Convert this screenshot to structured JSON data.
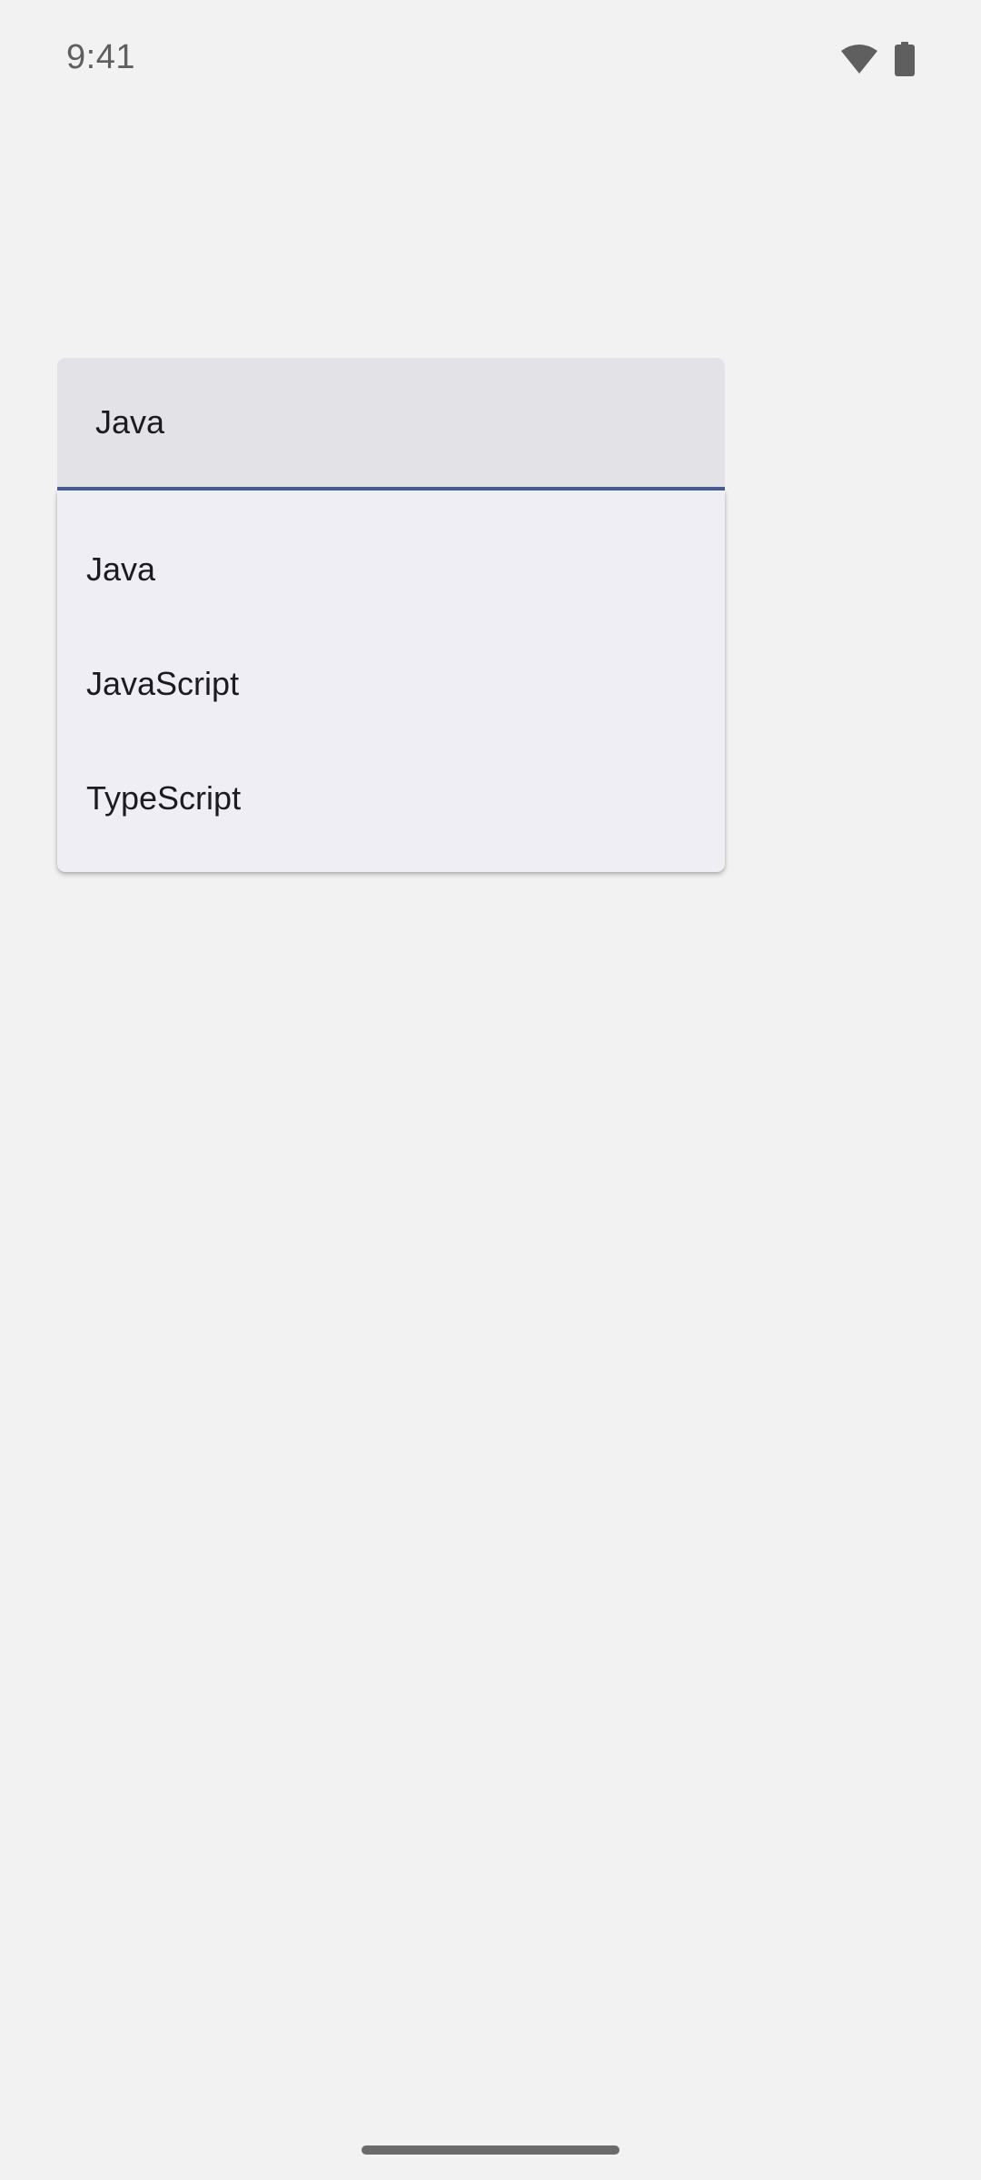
{
  "status_bar": {
    "time": "9:41",
    "icons": [
      "wifi-icon",
      "battery-icon"
    ]
  },
  "text_field": {
    "value": "Java"
  },
  "dropdown": {
    "items": [
      {
        "label": "Java"
      },
      {
        "label": "JavaScript"
      },
      {
        "label": "TypeScript"
      }
    ]
  },
  "colors": {
    "background": "#f2f2f2",
    "field_fill": "#e3e2e7",
    "field_indicator": "#475d92",
    "menu_surface": "#efeef4",
    "status_icons": "#5f5f5f"
  }
}
